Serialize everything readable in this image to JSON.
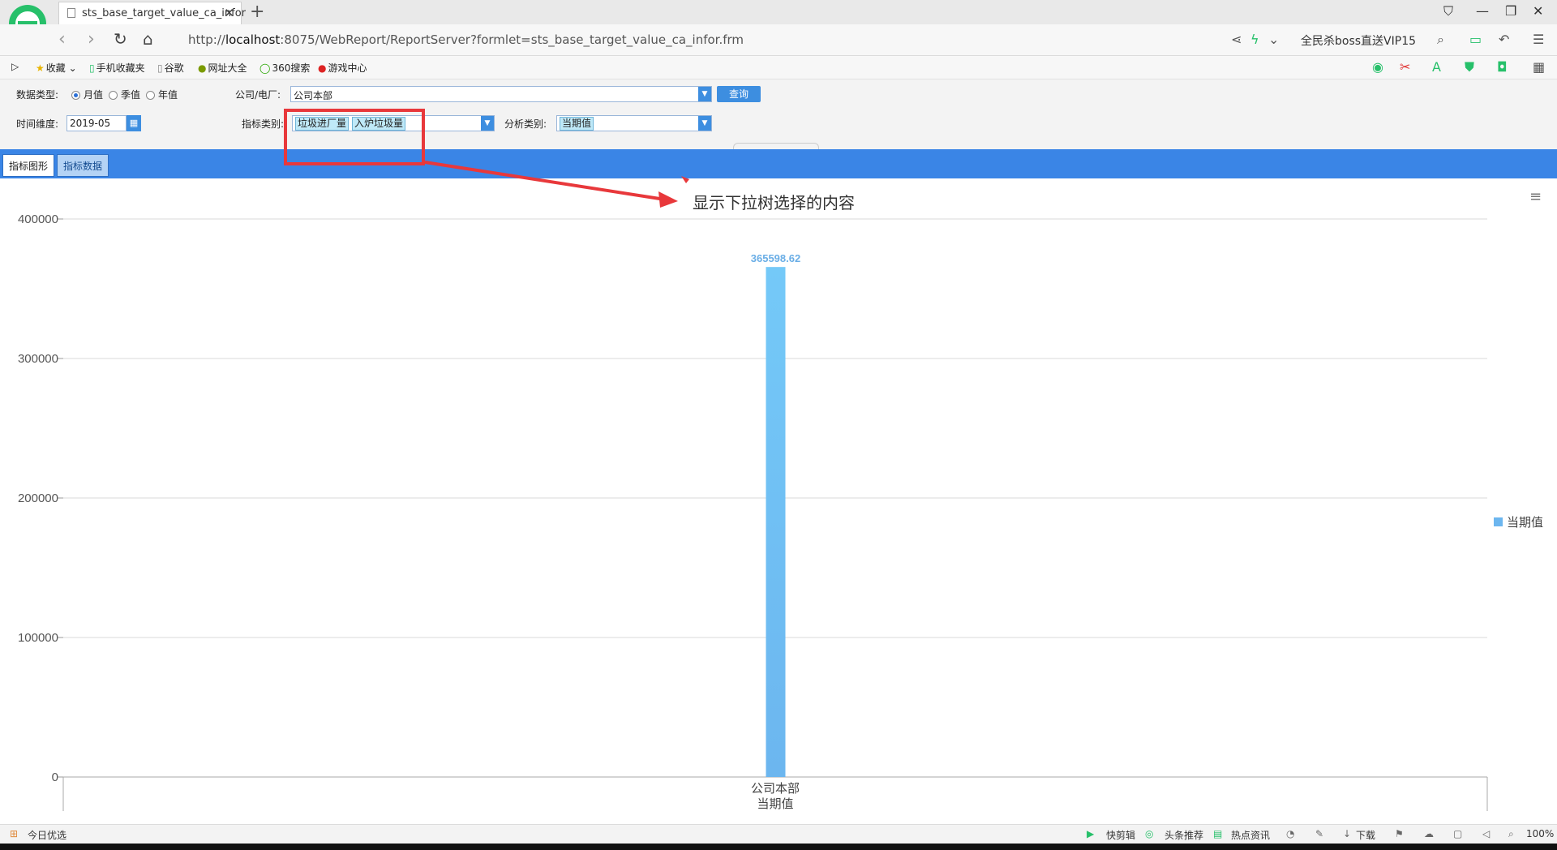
{
  "browser": {
    "tab_title": "sts_base_target_value_ca_infor",
    "url_host": "localhost",
    "url_prefix": "http://",
    "url_suffix": ":8075/WebReport/ReportServer?formlet=sts_base_target_value_ca_infor.frm",
    "promo_text": "全民杀boss直送VIP15"
  },
  "bookmarks": {
    "items": [
      "收藏",
      "手机收藏夹",
      "谷歌",
      "网址大全",
      "360搜索",
      "游戏中心"
    ]
  },
  "filters": {
    "data_type_label": "数据类型:",
    "data_type_options": [
      "月值",
      "季值",
      "年值"
    ],
    "data_type_selected": "月值",
    "company_label": "公司/电厂:",
    "company_value": "公司本部",
    "query_button": "查询",
    "time_label": "时间维度:",
    "time_value": "2019-05",
    "indicator_label": "指标类别:",
    "indicator_chips": [
      "垃圾进厂量",
      "入炉垃圾量"
    ],
    "analysis_label": "分析类别:",
    "analysis_value": "当期值"
  },
  "content_tabs": [
    "指标图形",
    "指标数据"
  ],
  "annotation": {
    "text": "显示下拉树选择的内容",
    "color": "#e8383b"
  },
  "chart_data": {
    "type": "bar",
    "categories": [
      "公司本部"
    ],
    "xlabel": "当期值",
    "series": [
      {
        "name": "当期值",
        "values": [
          365598.62
        ]
      }
    ],
    "data_labels": [
      "365598.62"
    ],
    "yticks": [
      "400000",
      "300000",
      "200000",
      "100000",
      "0"
    ],
    "ylim": [
      0,
      400000
    ],
    "grid": true,
    "legend": "right",
    "bar_color": "#6cb6ef"
  },
  "statusbar": {
    "left": "今日优选",
    "items": [
      "快剪辑",
      "头条推荐",
      "热点资讯",
      "下载"
    ],
    "zoom": "100%"
  }
}
